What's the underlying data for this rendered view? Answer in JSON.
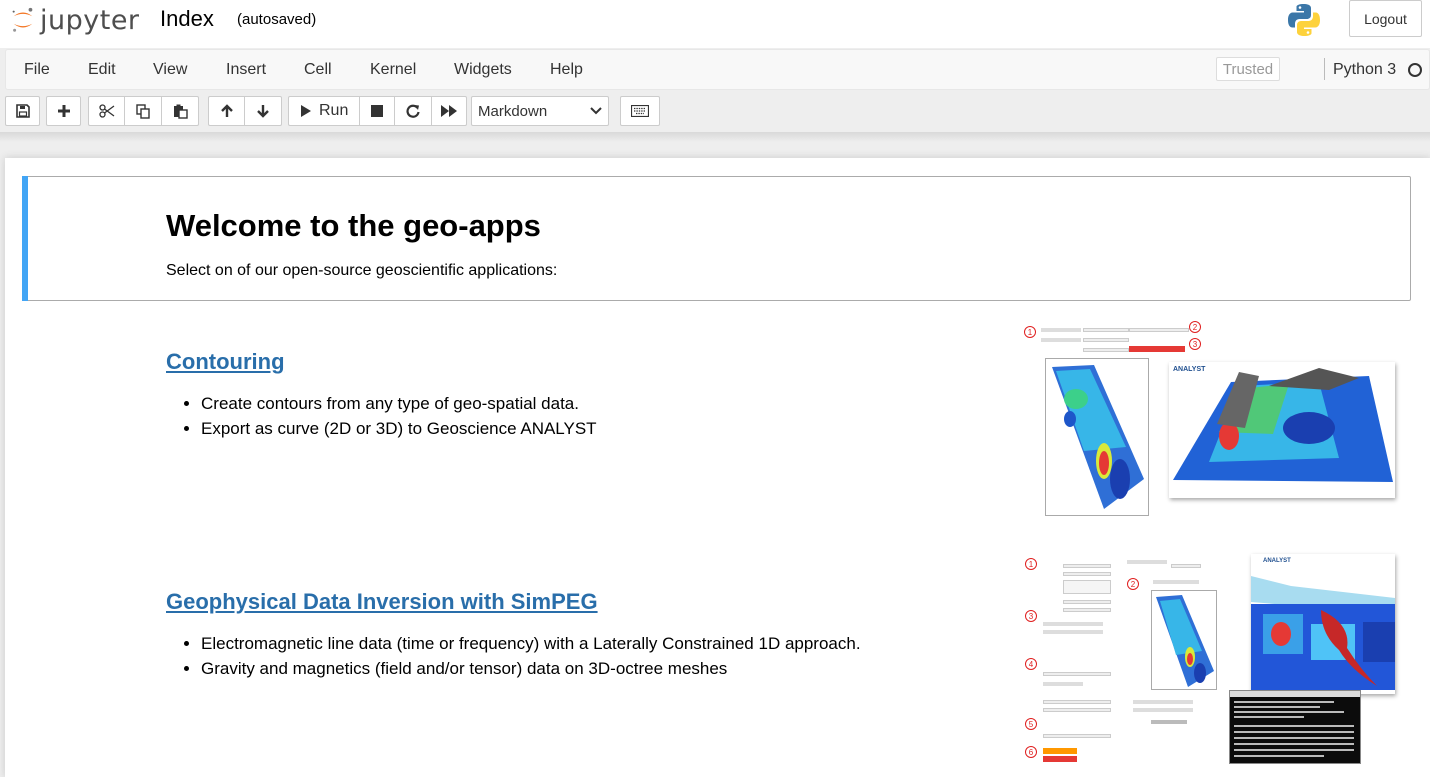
{
  "header": {
    "logo_text": "jupyter",
    "notebook_name": "Index",
    "autosave_status": "(autosaved)",
    "logout_label": "Logout"
  },
  "menu": {
    "items": [
      "File",
      "Edit",
      "View",
      "Insert",
      "Cell",
      "Kernel",
      "Widgets",
      "Help"
    ],
    "trusted_label": "Trusted",
    "kernel_name": "Python 3"
  },
  "toolbar": {
    "run_label": "Run",
    "cell_type": "Markdown",
    "icons": [
      "save-icon",
      "plus-icon",
      "scissors-icon",
      "copy-icon",
      "paste-icon",
      "arrow-up-icon",
      "arrow-down-icon",
      "play-icon",
      "stop-icon",
      "restart-icon",
      "fast-forward-icon",
      "keyboard-icon"
    ]
  },
  "content": {
    "title": "Welcome to the geo-apps",
    "subtitle": "Select on of our open-source geoscientific applications:",
    "apps": [
      {
        "name": "Contouring",
        "bullets": [
          "Create contours from any type of geo-spatial data.",
          "Export as curve (2D or 3D) to Geoscience ANALYST"
        ]
      },
      {
        "name": "Geophysical Data Inversion with SimPEG",
        "bullets": [
          "Electromagnetic line data (time or frequency) with a Laterally Constrained 1D approach.",
          "Gravity and magnetics (field and/or tensor) data on 3D-octree meshes"
        ]
      }
    ],
    "thumb_labels": {
      "analyst_brand": "ANALYST",
      "step_numbers": [
        "1",
        "2",
        "3",
        "4",
        "5",
        "6"
      ]
    }
  },
  "colors": {
    "selected_cell_bar": "#42a5f5",
    "link": "#296eaa",
    "jupyter_orange": "#f37726"
  }
}
